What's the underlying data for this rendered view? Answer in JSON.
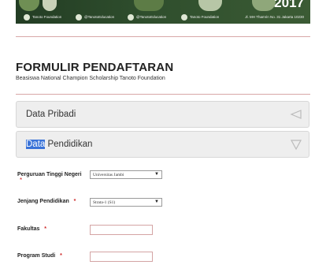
{
  "banner": {
    "year": "2017",
    "social": [
      {
        "icon": "facebook-icon",
        "label": "Tanoto Foundation"
      },
      {
        "icon": "instagram-icon",
        "label": "@TanotoEducation"
      },
      {
        "icon": "twitter-icon",
        "label": "@TanotoEducation"
      },
      {
        "icon": "youtube-icon",
        "label": "Tanoto Foundation"
      }
    ],
    "address": "Jl. MH Thamrin No. 31 Jakarta 10230"
  },
  "form": {
    "title": "FORMULIR PENDAFTARAN",
    "subtitle": "Beasiswa National Champion Scholarship Tanoto Foundation"
  },
  "accordion": [
    {
      "label": "Data Pribadi",
      "icon": "collapse-left-icon"
    },
    {
      "label_highlight": "Data",
      "label_rest": " Pendidikan",
      "icon": "expand-down-icon"
    }
  ],
  "fields": {
    "university": {
      "label": "Perguruan Tinggi Negeri",
      "required": "*",
      "value": "Universitas Jambi"
    },
    "education_level": {
      "label": "Jenjang Pendidikan",
      "required": "*",
      "value": "Strata-1 (S1)"
    },
    "faculty": {
      "label": "Fakultas",
      "required": "*",
      "value": ""
    },
    "study_program": {
      "label": "Program Studi",
      "required": "*",
      "value": ""
    }
  },
  "colors": {
    "banner_green": "#2f4e2d",
    "required_red": "#cc2222",
    "selection_blue": "#3a73d8"
  }
}
